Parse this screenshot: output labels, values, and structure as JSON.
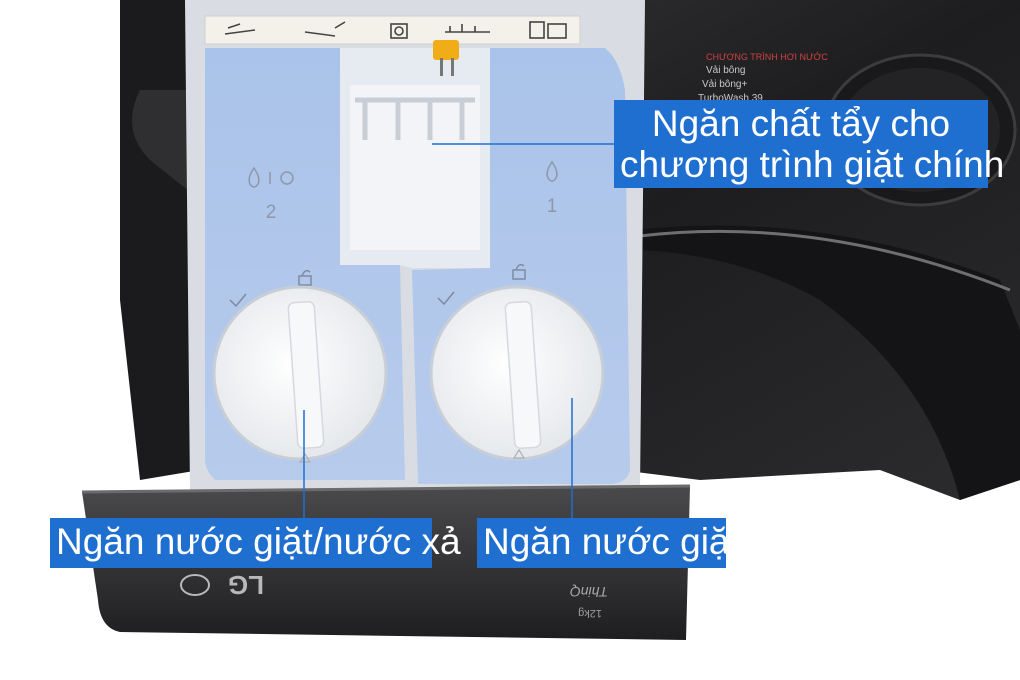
{
  "callouts": {
    "main_wash_bleach": {
      "line1": "Ngăn chất tẩy cho",
      "line2": "chương trình giặt chính"
    },
    "detergent_softener": "Ngăn nước giặt/nước xả",
    "detergent": "Ngăn nước giặt"
  },
  "drawer_labels": {
    "left_number": "2",
    "right_number": "1"
  },
  "machine_text": {
    "brand": "LG",
    "model_tag": "ThinQ",
    "capacity": "12kg",
    "panel_heading": "CHƯƠNG TRÌNH HƠI NƯỚC",
    "panel_lines": [
      "Vải bông",
      "Vải bông+",
      "TurboWash 39"
    ]
  },
  "colors": {
    "callout_bg": "#1f6fd1",
    "callout_text": "#ffffff",
    "drawer_blue": "#b9cdec",
    "machine_body": "#2a2a2c"
  }
}
